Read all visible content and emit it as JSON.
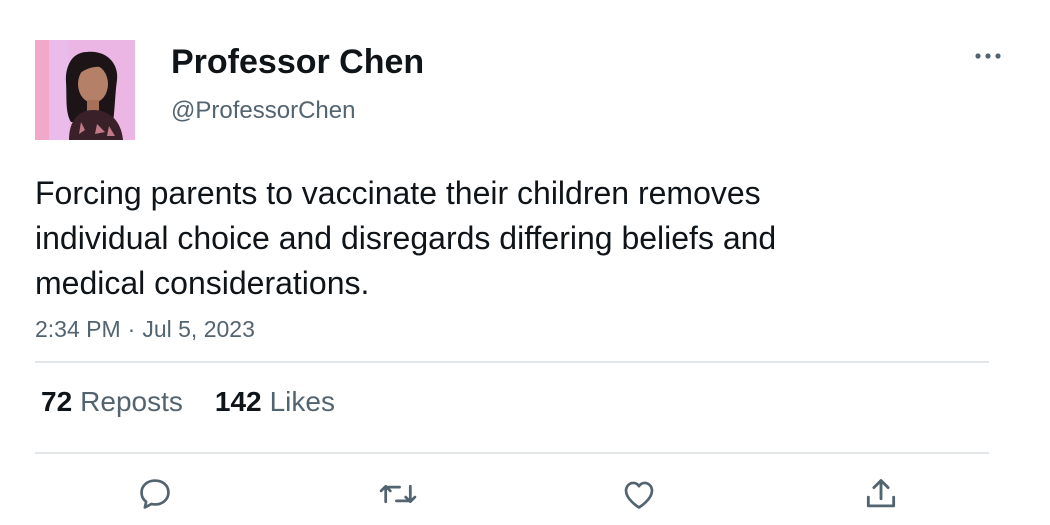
{
  "author": {
    "display_name": "Professor Chen",
    "handle": "@ProfessorChen"
  },
  "tweet": {
    "text": "Forcing parents to vaccinate their children removes\nindividual choice and disregards differing beliefs and\nmedical considerations.",
    "time": "2:34 PM",
    "separator": "·",
    "date": "Jul 5, 2023"
  },
  "stats": {
    "reposts_count": "72",
    "reposts_label": "Reposts",
    "likes_count": "142",
    "likes_label": "Likes"
  },
  "icons": {
    "more": "more-dots-icon",
    "reply": "reply-icon",
    "repost": "repost-icon",
    "like": "heart-icon",
    "share": "share-icon"
  },
  "colors": {
    "text_primary": "#0f1419",
    "text_secondary": "#536471",
    "divider": "#e3e6e9",
    "icon": "#536471"
  }
}
